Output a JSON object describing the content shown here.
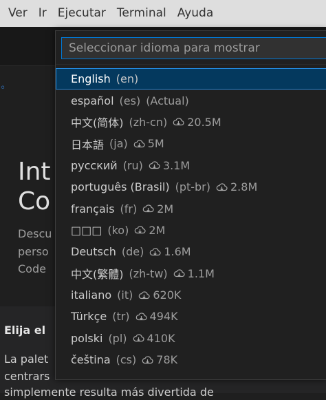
{
  "menubar": {
    "items": [
      "Ver",
      "Ir",
      "Ejecutar",
      "Terminal",
      "Ayuda"
    ]
  },
  "background": {
    "heading_lines": [
      "Int",
      "Co"
    ],
    "desc_lines": [
      "Descu",
      "perso",
      "Code"
    ],
    "card_title": "Elija el",
    "card_lines": [
      "La palet",
      "centrars",
      "simplemente resulta más divertida de"
    ]
  },
  "quick_pick": {
    "placeholder": "Seleccionar idioma para mostrar",
    "items": [
      {
        "name": "English",
        "code": "(en)",
        "tag": "",
        "size": ""
      },
      {
        "name": "español",
        "code": "(es)",
        "tag": "(Actual)",
        "size": ""
      },
      {
        "name": "中文(简体)",
        "code": "(zh-cn)",
        "tag": "",
        "size": "20.5M"
      },
      {
        "name": "日本語",
        "code": "(ja)",
        "tag": "",
        "size": "5M"
      },
      {
        "name": "русский",
        "code": "(ru)",
        "tag": "",
        "size": "3.1M"
      },
      {
        "name": "português (Brasil)",
        "code": "(pt-br)",
        "tag": "",
        "size": "2.8M"
      },
      {
        "name": "français",
        "code": "(fr)",
        "tag": "",
        "size": "2M"
      },
      {
        "name": "□□□",
        "code": "(ko)",
        "tag": "",
        "size": "2M"
      },
      {
        "name": "Deutsch",
        "code": "(de)",
        "tag": "",
        "size": "1.6M"
      },
      {
        "name": "中文(繁體)",
        "code": "(zh-tw)",
        "tag": "",
        "size": "1.1M"
      },
      {
        "name": "italiano",
        "code": "(it)",
        "tag": "",
        "size": "620K"
      },
      {
        "name": "Türkçe",
        "code": "(tr)",
        "tag": "",
        "size": "494K"
      },
      {
        "name": "polski",
        "code": "(pl)",
        "tag": "",
        "size": "410K"
      },
      {
        "name": "čeština",
        "code": "(cs)",
        "tag": "",
        "size": "78K"
      }
    ]
  },
  "colors": {
    "selection_bg": "#04395e",
    "focus_border": "#0078d4",
    "menubar_bg": "#dedede"
  }
}
